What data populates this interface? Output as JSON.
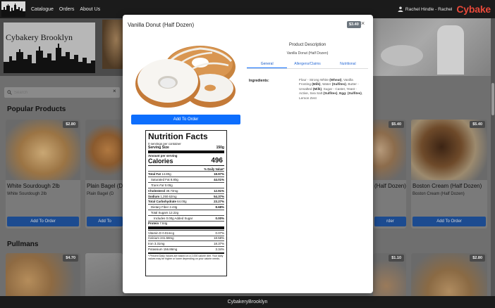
{
  "nav": {
    "links": [
      "Catalogue",
      "Orders",
      "About Us"
    ],
    "user": "Rachel Hindle - Rachel",
    "brand": "Cybake"
  },
  "hero": {
    "logo_text": "Cybakery Brooklyn"
  },
  "search": {
    "placeholder": "Search",
    "clear": "×"
  },
  "sections": {
    "popular": "Popular Products",
    "pullmans": "Pullmans"
  },
  "cards": [
    {
      "title": "White Sourdough 2lb",
      "subtitle": "White Sourdough 2lb",
      "price": "$2.80",
      "button": "Add To Order"
    },
    {
      "title": "Plain Bagel (D",
      "subtitle": "Plain Bagel (D",
      "price": "",
      "button": "Add To"
    },
    {
      "title": "(Half Dozen)",
      "subtitle": "",
      "price": "$5.40",
      "button": "rder"
    },
    {
      "title": "Boston Cream (Half Dozen)",
      "subtitle": "Boston Cream (Half Dozen)",
      "price": "$5.40",
      "button": "Add To Order"
    }
  ],
  "pullman_prices": [
    "$4.70",
    "$1.10",
    "$2.80"
  ],
  "footer": "CybakeryBrooklyn",
  "modal": {
    "title": "Vanilla Donut (Half Dozen)",
    "price": "$3.40",
    "close": "×",
    "add_button": "Add To Order",
    "description_heading": "Product Description",
    "description_name": "Vanilla Donut (Half Dozen)",
    "tabs": [
      "General",
      "Allergens/Claims",
      "Nutritional"
    ],
    "active_tab": "General",
    "ingredients_label": "Ingredients:",
    "ingredients": [
      {
        "t": "Flour - Strong White "
      },
      {
        "t": "(Wheat)",
        "b": true
      },
      {
        "t": ", Vanilla Frosting "
      },
      {
        "t": "(Milk)",
        "b": true
      },
      {
        "t": ", Water "
      },
      {
        "t": "(Sulfites)",
        "b": true
      },
      {
        "t": ", Butter - Unsalted "
      },
      {
        "t": "(Milk)",
        "b": true
      },
      {
        "t": ", Sugar - Caster, Yeast - Active, Sea Salt "
      },
      {
        "t": "(Sulfites)",
        "b": true
      },
      {
        "t": ", "
      },
      {
        "t": "Egg: (Sulfites)",
        "b": true
      },
      {
        "t": ", Lemon Zest"
      }
    ]
  },
  "nutrition": {
    "title": "Nutrition Facts",
    "servings": "0 servings per container",
    "serving_size_label": "Serving Size",
    "serving_size": "150g",
    "amount_label": "Amount per serving",
    "calories_label": "Calories",
    "calories": "496",
    "dv_label": "% Daily Value*",
    "rows": [
      {
        "label": "Total Fat",
        "value": "14.80g",
        "pct": "18.97%",
        "bold": true,
        "indent": 0
      },
      {
        "label": "Saturated Fat",
        "value": "8.80g",
        "pct": "44.01%",
        "bold": false,
        "indent": 1
      },
      {
        "label": "Trans Fat",
        "value": "0.00g",
        "pct": "",
        "bold": false,
        "indent": 1,
        "italic_label": true
      },
      {
        "label": "Cholesterol",
        "value": "38.73mg",
        "pct": "12.91%",
        "bold": true,
        "indent": 0
      },
      {
        "label": "Sodium",
        "value": "1,250.62mg",
        "pct": "54.37%",
        "bold": true,
        "indent": 0
      },
      {
        "label": "Total Carbohydrate",
        "value": "64.00g",
        "pct": "23.27%",
        "bold": true,
        "indent": 0
      },
      {
        "label": "Dietary Fiber",
        "value": "2.43g",
        "pct": "8.68%",
        "bold": false,
        "indent": 1
      },
      {
        "label": "Total Sugars",
        "value": "12.22g",
        "pct": "",
        "bold": false,
        "indent": 1
      },
      {
        "label": "Includes",
        "value": "0.00g Added Sugar",
        "pct": "0.00%",
        "bold": false,
        "indent": 2
      },
      {
        "label": "Protein",
        "value": "7.84g",
        "pct": "",
        "bold": true,
        "indent": 0
      }
    ],
    "vitamins": [
      {
        "label": "Vitamin D",
        "value": "0.01mcg",
        "pct": "0.07%"
      },
      {
        "label": "Calcium",
        "value": "241.58mg",
        "pct": "18.58%"
      },
      {
        "label": "Iron",
        "value": "3.31mg",
        "pct": "18.37%"
      },
      {
        "label": "Potassium",
        "value": "156.86mg",
        "pct": "3.34%"
      }
    ],
    "footnote": "* Percent Daily Values are based on a 2,000 calorie diet. Your daily values may be higher or lower depending on your calorie needs."
  }
}
